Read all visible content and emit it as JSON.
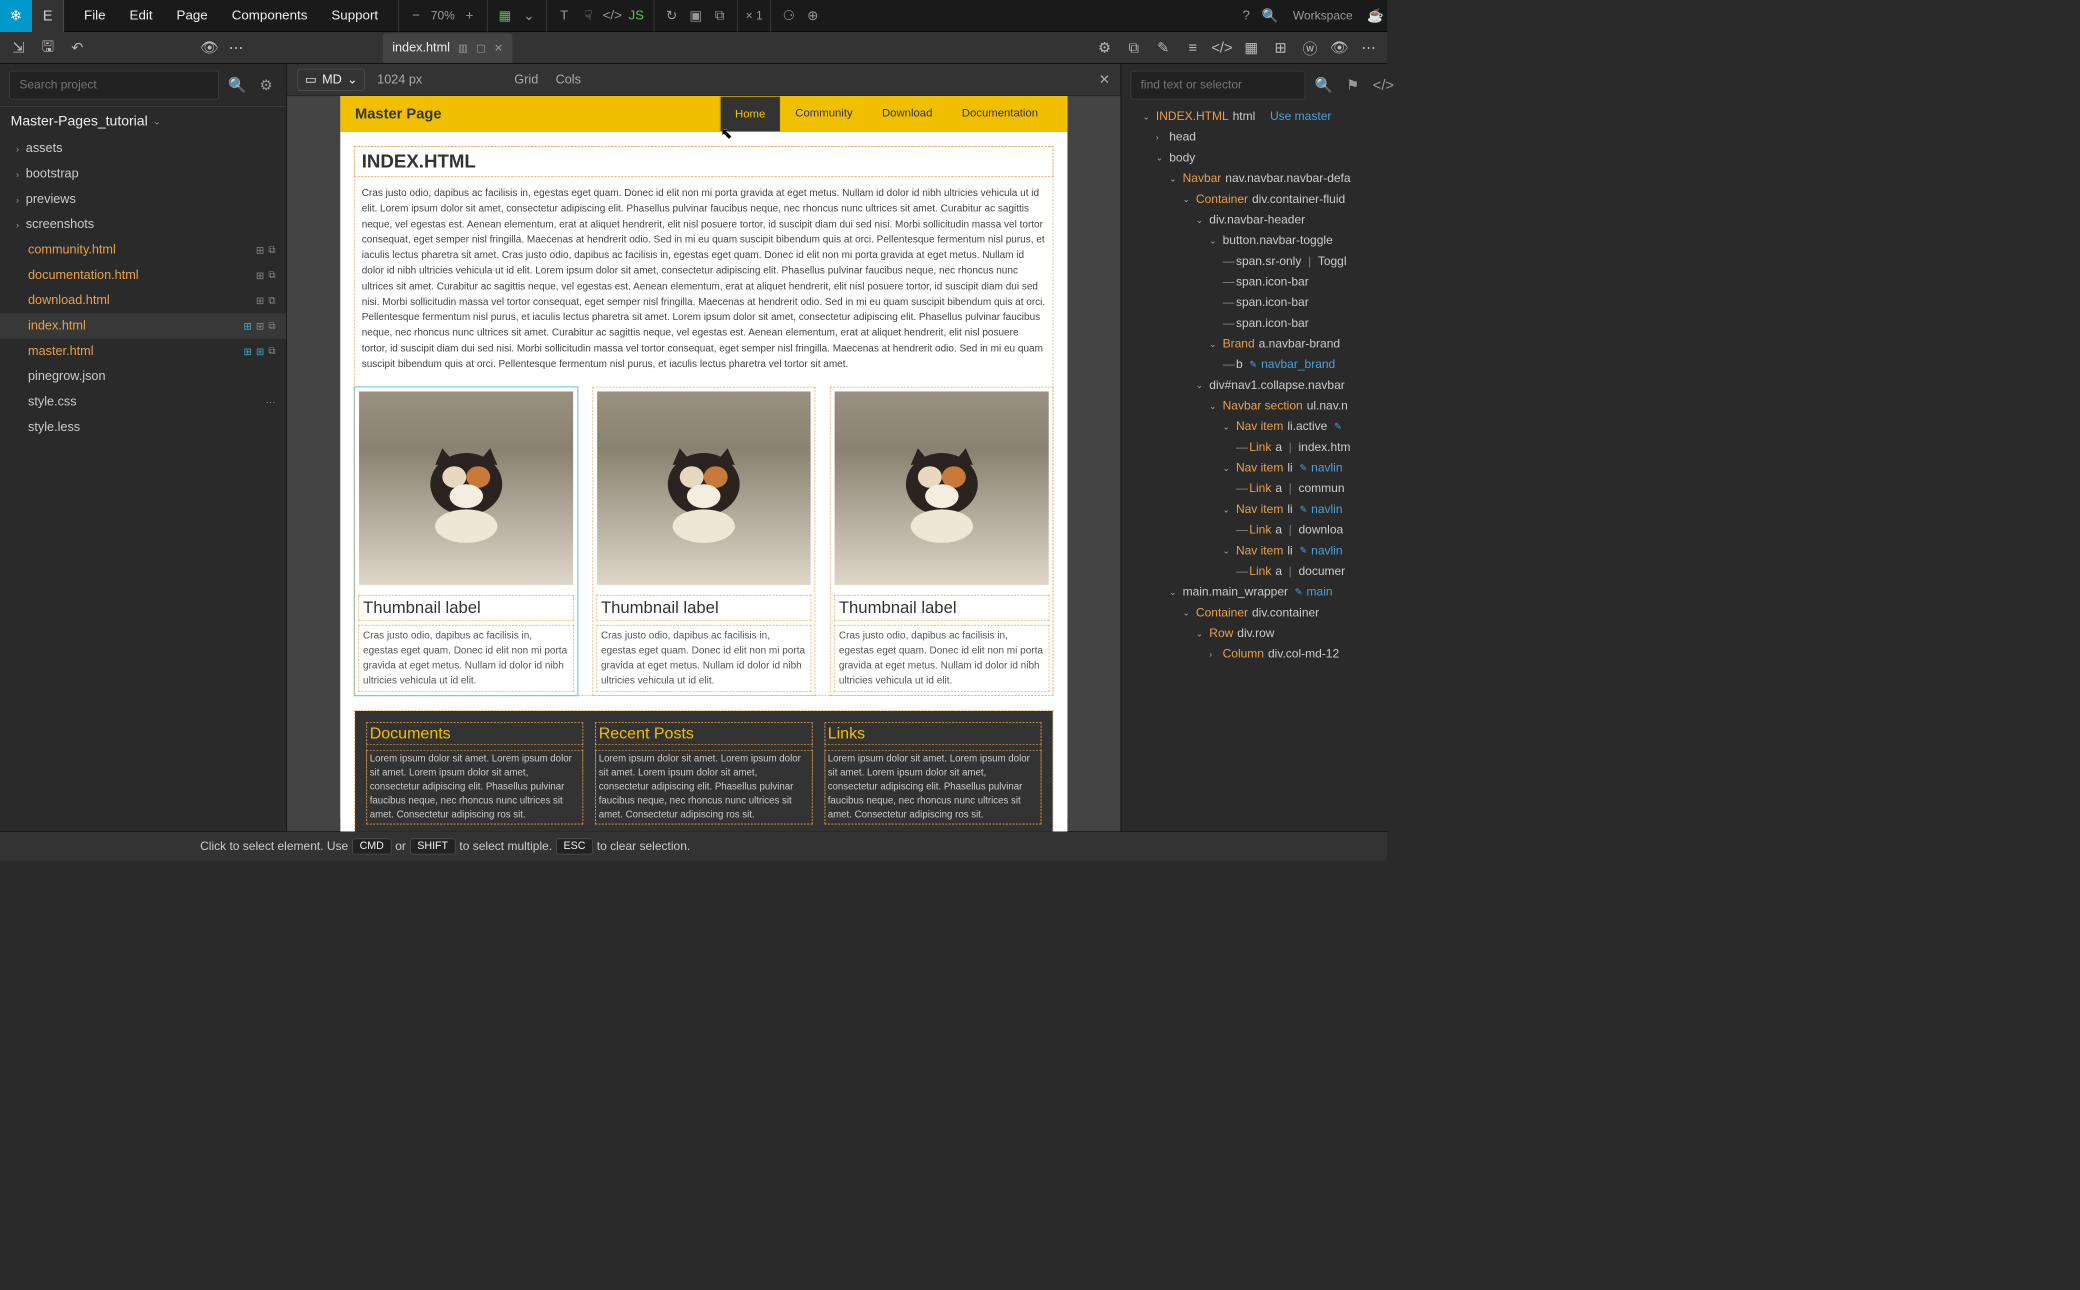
{
  "menu": {
    "file": "File",
    "edit": "Edit",
    "page": "Page",
    "components": "Components",
    "support": "Support"
  },
  "zoom": "70%",
  "multiplier": "× 1",
  "workspace": "Workspace",
  "tab": {
    "name": "index.html"
  },
  "leftSearch": {
    "placeholder": "Search project"
  },
  "project": {
    "name": "Master-Pages_tutorial"
  },
  "tree": {
    "folders": [
      "assets",
      "bootstrap",
      "previews",
      "screenshots"
    ],
    "files": [
      "community.html",
      "documentation.html",
      "download.html",
      "index.html",
      "master.html",
      "pinegrow.json",
      "style.css",
      "style.less"
    ]
  },
  "canvas": {
    "device": "MD",
    "px": "1024 px",
    "grid": "Grid",
    "cols": "Cols"
  },
  "preview": {
    "brand": "Master Page",
    "nav": [
      "Home",
      "Community",
      "Download",
      "Documentation"
    ],
    "h1": "INDEX.HTML",
    "para": "Cras justo odio, dapibus ac facilisis in, egestas eget quam. Donec id elit non mi porta gravida at eget metus. Nullam id dolor id nibh ultricies vehicula ut id elit. Lorem ipsum dolor sit amet, consectetur adipiscing elit. Phasellus pulvinar faucibus neque, nec rhoncus nunc ultrices sit amet. Curabitur ac sagittis neque, vel egestas est. Aenean elementum, erat at aliquet hendrerit, elit nisl posuere tortor, id suscipit diam dui sed nisi. Morbi sollicitudin massa vel tortor consequat, eget semper nisl fringilla. Maecenas at hendrerit odio. Sed in mi eu quam suscipit bibendum quis at orci. Pellentesque fermentum nisl purus, et iaculis lectus pharetra sit amet. Cras justo odio, dapibus ac facilisis in, egestas eget quam. Donec id elit non mi porta gravida at eget metus. Nullam id dolor id nibh ultricies vehicula ut id elit. Lorem ipsum dolor sit amet, consectetur adipiscing elit. Phasellus pulvinar faucibus neque, nec rhoncus nunc ultrices sit amet. Curabitur ac sagittis neque, vel egestas est. Aenean elementum, erat at aliquet hendrerit, elit nisl posuere tortor, id suscipit diam dui sed nisi. Morbi sollicitudin massa vel tortor consequat, eget semper nisl fringilla. Maecenas at hendrerit odio. Sed in mi eu quam suscipit bibendum quis at orci. Pellentesque fermentum nisl purus, et iaculis lectus pharetra sit amet. Lorem ipsum dolor sit amet, consectetur adipiscing elit. Phasellus pulvinar faucibus neque, nec rhoncus nunc ultrices sit amet. Curabitur ac sagittis neque, vel egestas est. Aenean elementum, erat at aliquet hendrerit, elit nisl posuere tortor, id suscipit diam dui sed nisi. Morbi sollicitudin massa vel tortor consequat, eget semper nisl fringilla. Maecenas at hendrerit odio. Sed in mi eu quam suscipit bibendum quis at orci. Pellentesque fermentum nisl purus, et iaculis lectus pharetra vel tortor sit amet.",
    "thumb_title": "Thumbnail label",
    "thumb_text": "Cras justo odio, dapibus ac facilisis in, egestas eget quam. Donec id elit non mi porta gravida at eget metus. Nullam id dolor id nibh ultricies vehicula ut id elit.",
    "footer": {
      "cols": [
        "Documents",
        "Recent Posts",
        "Links"
      ],
      "text": "Lorem ipsum dolor sit amet. Lorem ipsum dolor sit amet. Lorem ipsum dolor sit amet, consectetur adipiscing elit. Phasellus pulvinar faucibus neque, nec rhoncus nunc ultrices sit amet. Consectetur adipiscing ros sit."
    }
  },
  "rightSearch": {
    "placeholder": "find text or selector"
  },
  "dom": {
    "root_file": "INDEX.HTML",
    "root_tag": "html",
    "use_master": "Use master",
    "head": "head",
    "body": "body",
    "navbar": "Navbar",
    "navbar_sel": "nav.navbar.navbar-defa",
    "container": "Container",
    "container_sel": "div.container-fluid",
    "nav_header": "div.navbar-header",
    "toggle": "button.navbar-toggle",
    "sr": "span.sr-only",
    "sr_txt": "Toggl",
    "iconbar": "span.icon-bar",
    "brand": "Brand",
    "brand_sel": "a.navbar-brand",
    "brand_b": "b",
    "brand_var": "navbar_brand",
    "collapse": "div#nav1.collapse.navbar",
    "nav_section": "Navbar section",
    "nav_section_sel": "ul.nav.n",
    "nav_item": "Nav item",
    "li": "li",
    "li_active": "li.active",
    "link": "Link",
    "a": "a",
    "link_txts": [
      "index.htm",
      "commun",
      "downloa",
      "documer"
    ],
    "navlin": "navlin",
    "main": "main.main_wrapper",
    "main_txt": "main",
    "main_container_sel": "div.container",
    "row": "Row",
    "row_sel": "div.row",
    "column": "Column",
    "column_sel": "div.col-md-12"
  },
  "status": {
    "t1": "Click to select element. Use",
    "k1": "CMD",
    "t2": "or",
    "k2": "SHIFT",
    "t3": "to select multiple.",
    "k3": "ESC",
    "t4": "to clear selection."
  }
}
